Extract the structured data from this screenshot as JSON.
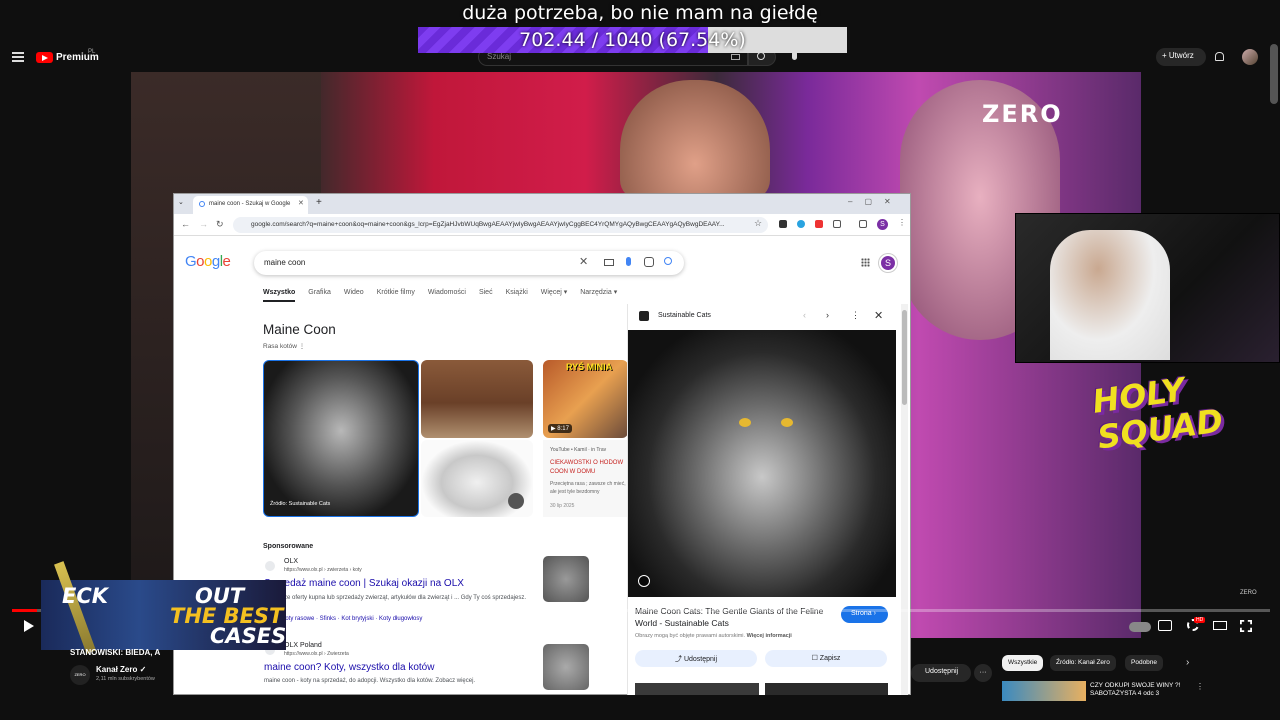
{
  "overlay": {
    "title": "duża potrzeba, bo nie mam na giełdę",
    "progress_text": "702.44 / 1040 (67.54%)",
    "progress_fraction": 0.6754
  },
  "yt_header": {
    "brand": "Premium",
    "brand_sup": "PL",
    "search_placeholder": "Szukaj",
    "create_label": "Utwórz"
  },
  "video": {
    "channel_logo": "ZERO",
    "corner_logo": "ZERO",
    "holy_text": "HOLY SQUAD"
  },
  "browser": {
    "tab_title": "maine coon - Szukaj w Google",
    "address": "google.com/search?q=maine+coon&oq=maine+coon&gs_lcrp=EgZjaHJvbWUqBwgAEAAYjwIyBwgAEAAYjwIyCggBEC4YrQMYgAQyBwgCEAAYgAQyBwgDEAAY...",
    "profile_letter": "S"
  },
  "google": {
    "logo": [
      "G",
      "o",
      "o",
      "g",
      "l",
      "e"
    ],
    "query": "maine coon",
    "tabs": [
      "Wszystko",
      "Grafika",
      "Wideo",
      "Krótkie filmy",
      "Wiadomości",
      "Sieć",
      "Książki",
      "Więcej ▾",
      "Narzędzia ▾"
    ],
    "kp_title": "Maine Coon",
    "kp_subtitle": "Rasa kotów",
    "main_image_caption": "Źródło: Sustainable Cats",
    "yt_thumb_title": "RYŚ MINIA",
    "yt_thumb_duration": "▶ 8:17",
    "yt_card": {
      "source": "YouTube • Kamil · in Trav",
      "title": "CIEKAWOSTKI O HODOW COON W DOMU",
      "desc": "Przeciętna rasa ; zawsze ch mieć, ale jest tyle bezdomny",
      "date": "30 lip 2025"
    },
    "sponsored": "Sponsorowane",
    "ad1": {
      "name": "OLX",
      "url": "https://www.olx.pl › zwierzeta › koty",
      "title": "Sprzedaż maine coon | Szukaj okazji na OLX",
      "desc": "Najlepsze oferty kupna lub sprzedaży zwierząt, artykułów dla zwierząt i ... Gdy Ty coś sprzedajesz.",
      "links": "Koty · Koty rasowe · Sfinks · Kot brytyjski · Koty długowłosy"
    },
    "ad2": {
      "name": "OLX Poland",
      "url": "https://www.olx.pl › Zwierzeta",
      "title": "maine coon? Koty, wszystko dla kotów",
      "desc": "maine coon - koty na sprzedaż, do adopcji. Wszystko dla kotów. Zobacz więcej."
    }
  },
  "panel": {
    "source": "Sustainable Cats",
    "title": "Maine Coon Cats: The Gentle Giants of the Feline World - Sustainable Cats",
    "visit_label": "Strona ›",
    "note": "Obrazy mogą być objęte prawami autorskimi.",
    "note_link": "Więcej informacji",
    "share_label": "Udostępnij",
    "save_label": "Zapisz"
  },
  "case_overlay": {
    "line1": "ECK",
    "line2": "OUT",
    "line3": "THE BEST",
    "line4": "CASES"
  },
  "below": {
    "video_title": "STANOWISKI: BIEDA, A",
    "channel_avatar": "ZERO",
    "channel_name": "Kanał Zero ✓",
    "channel_subs": "2,11 mln subskrybentów",
    "share_label": "Udostępnij",
    "more_label": "···",
    "chips": [
      "Wszystkie",
      "Źródło: Kanał Zero",
      "Podobne"
    ],
    "rec_title": "CZY ODKUPI SWOJE WINY ?! SABOTAŻYSTA 4 odc 3"
  },
  "player": {
    "progress_fraction": 0.02,
    "hd_badge": "HD"
  },
  "icons": [
    "menu-icon",
    "search-icon",
    "mic-icon",
    "bell-icon",
    "play-icon",
    "gear-icon",
    "close-icon",
    "star-icon"
  ]
}
